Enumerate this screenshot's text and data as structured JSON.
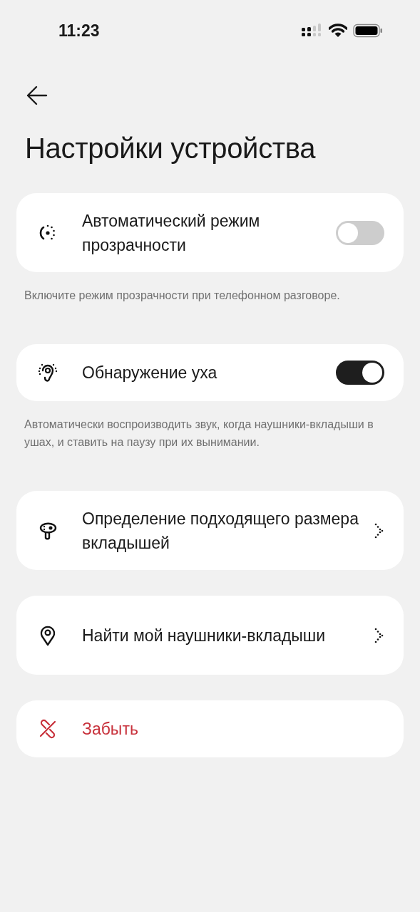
{
  "status_bar": {
    "time": "11:23"
  },
  "title": "Настройки устройства",
  "items": [
    {
      "kind": "toggle",
      "label": "Автоматический режим прозрачности",
      "on": false,
      "description": "Включите режим прозрачности при телефонном разговоре."
    },
    {
      "kind": "toggle",
      "label": "Обнаружение уха",
      "on": true,
      "description": "Автоматически воспроизводить звук, когда наушники-вкладыши в ушах, и ставить на паузу при их вынимании."
    },
    {
      "kind": "link",
      "label": "Определение подходящего размера вкладышей"
    },
    {
      "kind": "link",
      "label": "Найти мой наушники-вкладыши"
    },
    {
      "kind": "danger",
      "label": "Забыть"
    }
  ]
}
